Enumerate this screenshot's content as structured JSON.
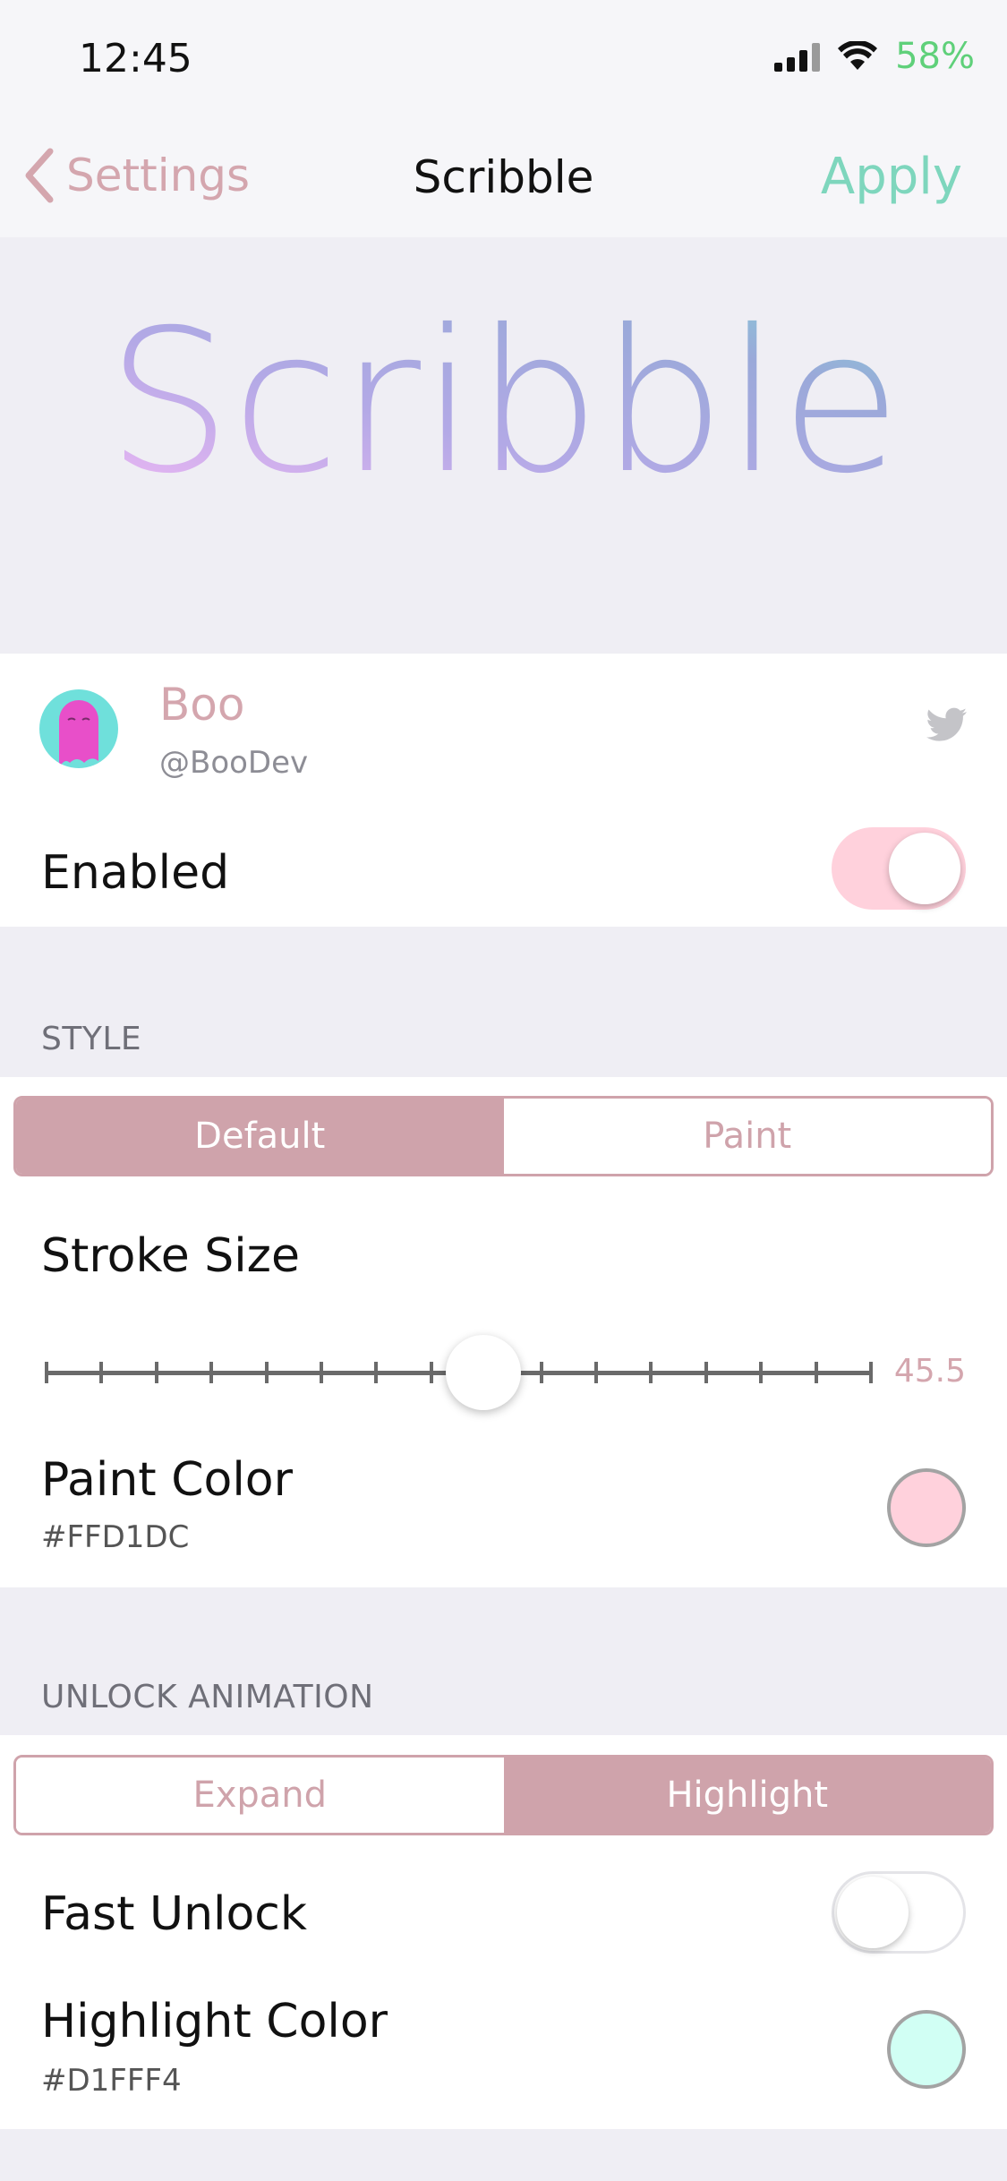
{
  "status_bar": {
    "time": "12:45",
    "battery_percent": "58%",
    "signal_icon": "cellular-signal-icon",
    "wifi_icon": "wifi-icon"
  },
  "nav": {
    "back_label": "Settings",
    "title": "Scribble",
    "apply_label": "Apply"
  },
  "banner": {
    "logo_text": "Scribble"
  },
  "developer": {
    "name": "Boo",
    "handle": "@BooDev",
    "link_icon": "twitter-icon"
  },
  "enabled": {
    "label": "Enabled",
    "value": true
  },
  "style_section": {
    "header": "STYLE",
    "options": [
      "Default",
      "Paint"
    ],
    "selected": "Default",
    "stroke_size_label": "Stroke Size",
    "stroke_size_value": "45.5",
    "stroke_size_fraction": 0.53,
    "paint_color_label": "Paint Color",
    "paint_color_hex": "#FFD1DC"
  },
  "unlock_section": {
    "header": "UNLOCK ANIMATION",
    "options": [
      "Expand",
      "Highlight"
    ],
    "selected": "Highlight",
    "fast_unlock_label": "Fast Unlock",
    "fast_unlock_value": false,
    "highlight_color_label": "Highlight Color",
    "highlight_color_hex": "#D1FFF4"
  },
  "colors": {
    "accent": "#CFA3AB",
    "apply_green": "#7ED6BD",
    "battery_green": "#5FD07A",
    "toggle_on": "#FFD1DC"
  }
}
